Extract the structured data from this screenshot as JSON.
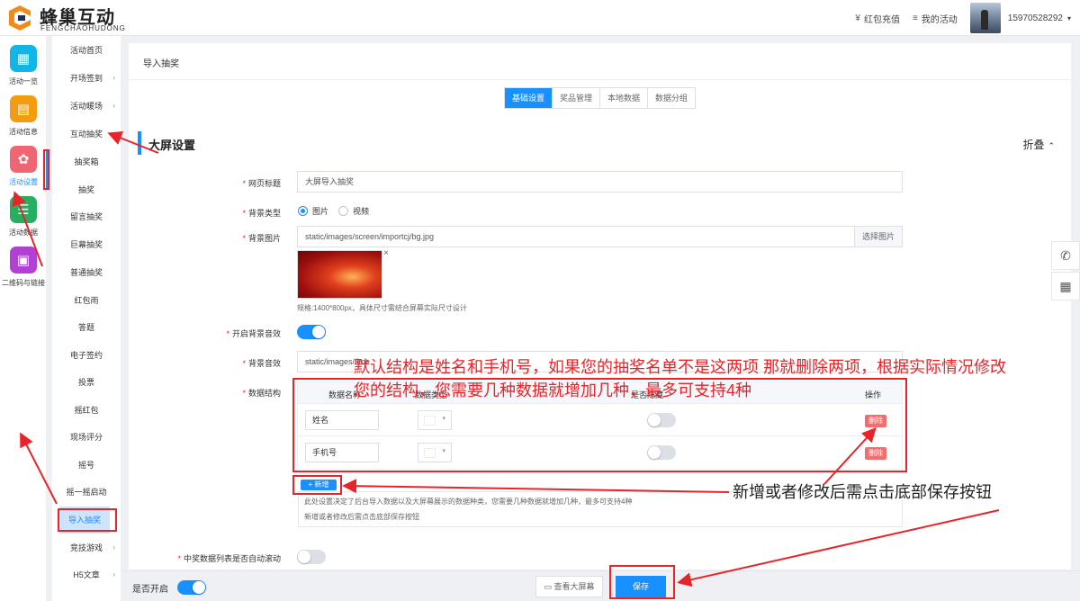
{
  "brand": {
    "name_cn": "蜂巢互动",
    "name_en": "FENGCHAOHUDONG",
    "logo": "logo-icon"
  },
  "header": {
    "recharge": "红包充值",
    "recharge_icon": "¥",
    "my_activity": "我的活动",
    "my_activity_icon": "≡",
    "username": "15970528292",
    "caret": "▾"
  },
  "icon_nav": [
    {
      "label": "活动一览",
      "icon": "grid-icon",
      "color": "#12b5e8",
      "glyph": "▦"
    },
    {
      "label": "活动信息",
      "icon": "document-icon",
      "color": "#f39c12",
      "glyph": "▤"
    },
    {
      "label": "活动设置",
      "icon": "gear-icon",
      "color": "#f06573",
      "glyph": "✿"
    },
    {
      "label": "活动数据",
      "icon": "database-icon",
      "color": "#27ae60",
      "glyph": "☰"
    },
    {
      "label": "二维码与链接",
      "icon": "qrcode-icon",
      "color": "#b340d4",
      "glyph": "▣"
    }
  ],
  "sub_nav": [
    {
      "label": "活动首页",
      "arrow": ""
    },
    {
      "label": "开场签到",
      "arrow": "›"
    },
    {
      "label": "活动暖场",
      "arrow": "›"
    },
    {
      "label": "互动抽奖",
      "arrow": "⌄"
    },
    {
      "label": "抽奖箱",
      "arrow": ""
    },
    {
      "label": "抽奖",
      "arrow": ""
    },
    {
      "label": "留言抽奖",
      "arrow": ""
    },
    {
      "label": "巨幕抽奖",
      "arrow": ""
    },
    {
      "label": "普通抽奖",
      "arrow": ""
    },
    {
      "label": "红包雨",
      "arrow": ""
    },
    {
      "label": "答题",
      "arrow": ""
    },
    {
      "label": "电子签约",
      "arrow": ""
    },
    {
      "label": "投票",
      "arrow": ""
    },
    {
      "label": "摇红包",
      "arrow": ""
    },
    {
      "label": "现场评分",
      "arrow": ""
    },
    {
      "label": "摇号",
      "arrow": ""
    },
    {
      "label": "摇一摇启动",
      "arrow": ""
    },
    {
      "label": "导入抽奖",
      "arrow": ""
    },
    {
      "label": "竞技游戏",
      "arrow": "›"
    },
    {
      "label": "H5文章",
      "arrow": "›"
    }
  ],
  "page": {
    "breadcrumb": "导入抽奖",
    "tabs": [
      "基础设置",
      "奖品管理",
      "本地数据",
      "数据分组"
    ],
    "section_title": "大屏设置",
    "collapse": "折叠",
    "collapse_icon": "»"
  },
  "form": {
    "title_label": "网页标题",
    "title_value": "大屏导入抽奖",
    "bg_type_label": "背景类型",
    "bg_type_options": [
      "图片",
      "视频"
    ],
    "bg_image_label": "背景图片",
    "bg_image_value": "static/images/screen/importcj/bg.jpg",
    "bg_image_button": "选择图片",
    "thumb_close": "×",
    "bg_hint": "规格:1400*800px，具体尺寸需结合屏幕实际尺寸设计",
    "bg_sound_switch_label": "开启背景音效",
    "bg_sound_label": "背景音效",
    "bg_sound_value": "static/images/",
    "bg_sound_value_tail": "/ime",
    "data_struct_label": "数据结构",
    "auto_scroll_label": "中奖数据列表是否自动滚动"
  },
  "table": {
    "headers": [
      "数据名称",
      "数据类型",
      "是否隐藏",
      "操作"
    ],
    "rows": [
      {
        "name": "姓名",
        "delete": "删除"
      },
      {
        "name": "手机号",
        "delete": "删除"
      }
    ],
    "add_button": "+ 新增",
    "note_line1": "此处设置决定了后台导入数据以及大屏幕展示的数据种类，您需要几种数据就增加几种，最多可支持4种",
    "note_line2": "新增或者修改后需点击底部保存按钮"
  },
  "bottom": {
    "enable_label": "是否开启",
    "view_screen": "查看大屏幕",
    "view_icon": "▭",
    "save": "保存"
  },
  "floating": {
    "phone_icon": "phone-icon",
    "phone_glyph": "✆",
    "qr_icon": "qrcode-icon",
    "qr_glyph": "▦"
  },
  "annotations": {
    "line1": "默认结构是姓名和手机号，如果您的抽奖名单不是这两项 那就删除两项，根据实际情况修改",
    "line2": "您的结构，您需要几种数据就增加几种，最多可支持4种",
    "line3": "新增或者修改后需点击底部保存按钮"
  },
  "colors": {
    "primary": "#1890ff",
    "danger": "#f56c6c",
    "annotation": "#e8242a"
  }
}
